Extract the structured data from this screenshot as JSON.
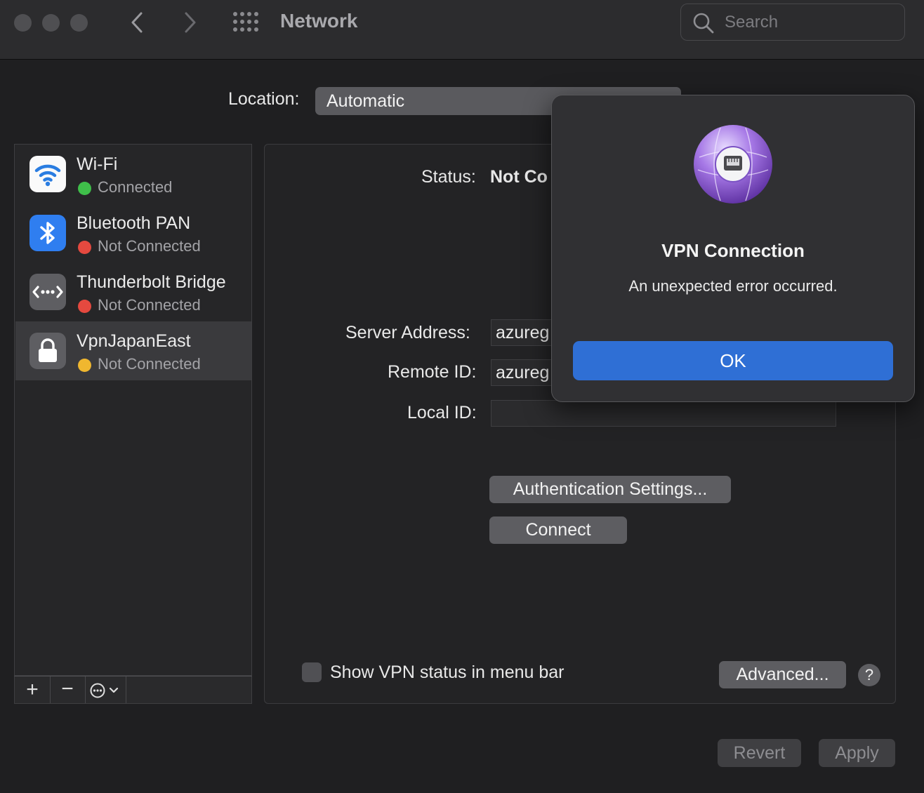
{
  "window": {
    "title": "Network",
    "search_placeholder": "Search"
  },
  "location": {
    "label": "Location:",
    "value": "Automatic"
  },
  "services": [
    {
      "name": "Wi-Fi",
      "status": "Connected",
      "status_color": "#3fbf4a",
      "icon": "wifi-icon"
    },
    {
      "name": "Bluetooth PAN",
      "status": "Not Connected",
      "status_color": "#e5493f",
      "icon": "bluetooth-icon"
    },
    {
      "name": "Thunderbolt Bridge",
      "status": "Not Connected",
      "status_color": "#e5493f",
      "icon": "thunderbolt-bridge-icon"
    },
    {
      "name": "VpnJapanEast",
      "status": "Not Connected",
      "status_color": "#f0b72f",
      "icon": "lock-icon"
    }
  ],
  "sidebar_actions": {
    "add": "+",
    "remove": "−"
  },
  "panel": {
    "status_label": "Status:",
    "status_value": "Not Co",
    "server_address_label": "Server Address:",
    "server_address_value": "azureg",
    "remote_id_label": "Remote ID:",
    "remote_id_value": "azureg",
    "local_id_label": "Local ID:",
    "local_id_value": "",
    "auth_button": "Authentication Settings...",
    "connect_button": "Connect",
    "show_vpn_status_label": "Show VPN status in menu bar",
    "show_vpn_status_checked": false,
    "advanced_button": "Advanced...",
    "help_button": "?"
  },
  "footer": {
    "revert_button": "Revert",
    "apply_button": "Apply"
  },
  "alert": {
    "title": "VPN Connection",
    "message": "An unexpected error occurred.",
    "ok_button": "OK",
    "accent_color": "#2f6fd5"
  }
}
